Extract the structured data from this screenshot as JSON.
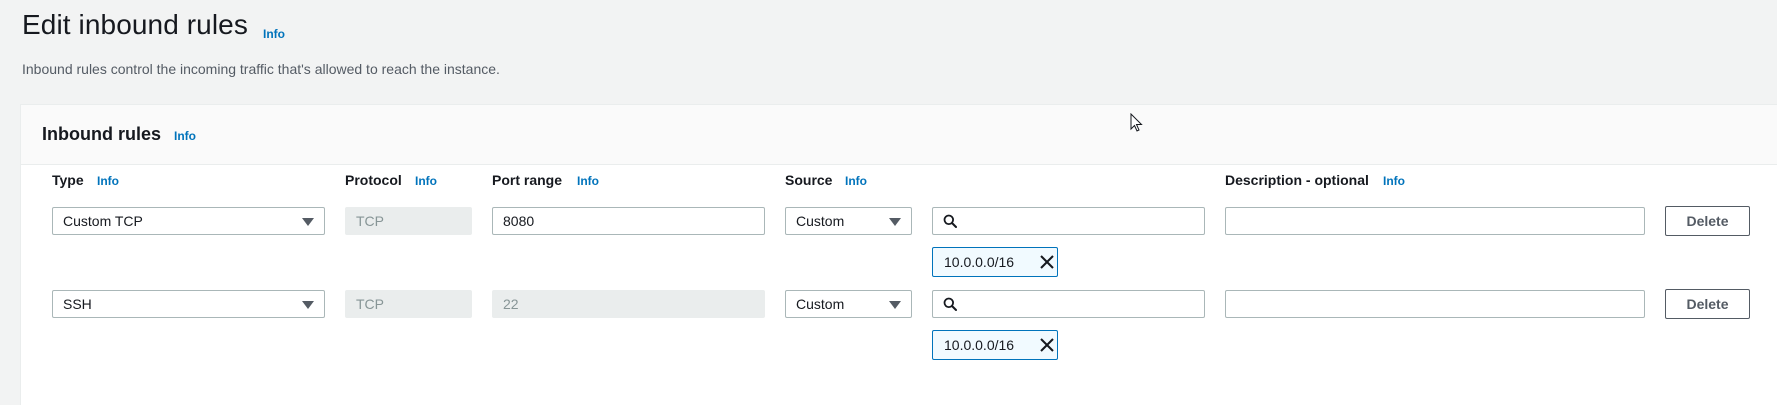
{
  "page": {
    "title": "Edit inbound rules",
    "title_info": "Info",
    "description": "Inbound rules control the incoming traffic that's allowed to reach the instance."
  },
  "panel": {
    "title": "Inbound rules",
    "info": "Info"
  },
  "columns": {
    "type": {
      "label": "Type",
      "info": "Info"
    },
    "protocol": {
      "label": "Protocol",
      "info": "Info"
    },
    "port_range": {
      "label": "Port range",
      "info": "Info"
    },
    "source": {
      "label": "Source",
      "info": "Info"
    },
    "description": {
      "label": "Description - optional",
      "info": "Info"
    }
  },
  "rules": [
    {
      "type": "Custom TCP",
      "protocol": "TCP",
      "port_range": "8080",
      "source_type": "Custom",
      "search_value": "",
      "source_token": "10.0.0.0/16",
      "description": "",
      "delete_label": "Delete"
    },
    {
      "type": "SSH",
      "protocol": "TCP",
      "port_range": "22",
      "source_type": "Custom",
      "search_value": "",
      "source_token": "10.0.0.0/16",
      "description": "",
      "delete_label": "Delete"
    }
  ],
  "colors": {
    "background": "#f2f3f3",
    "link": "#0073bb",
    "token_border": "#0073bb",
    "token_fill": "#f1faff",
    "disabled_fill": "#eaeded"
  },
  "icons": {
    "search": "search-icon",
    "caret": "caret-down-icon",
    "token_close": "close-icon",
    "pointer": "mouse-cursor-icon"
  }
}
